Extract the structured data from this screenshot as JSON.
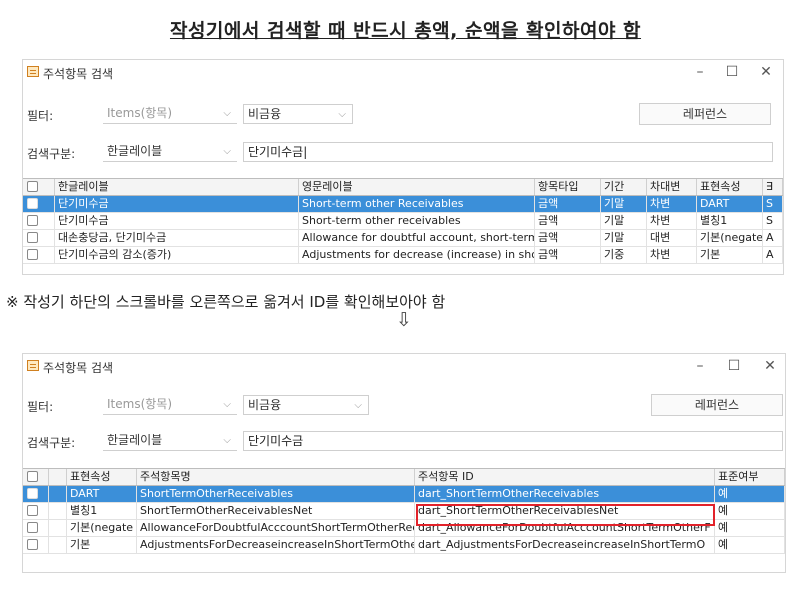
{
  "headline": "작성기에서 검색할 때 반드시 총액, 순액을 확인하여야 함",
  "note": "※ 작성기 하단의 스크롤바를 오른쪽으로 옮겨서 ID를 확인해보아야 함",
  "arrow_glyph": "⇩",
  "window_top": {
    "title": "주석항목 검색",
    "controls": {
      "minimize": "–",
      "maximize": "☐",
      "close": "✕"
    },
    "filter_label": "필터:",
    "filter_value": "Items(항목)",
    "filter2_value": "비금융",
    "reference_button": "레퍼런스",
    "search_type_label": "검색구분:",
    "search_type_value": "한글레이블",
    "search_input": "단기미수금|",
    "columns": [
      "",
      "한글레이블",
      "영문레이블",
      "항목타입",
      "기간",
      "차대변",
      "표현속성",
      "∃"
    ],
    "rows": [
      [
        "",
        "단기미수금",
        "Short-term other Receivables",
        "금액",
        "기말",
        "차변",
        "DART",
        "S"
      ],
      [
        "",
        "단기미수금",
        "Short-term other receivables",
        "금액",
        "기말",
        "차변",
        "별칭1",
        "S"
      ],
      [
        "",
        "대손충당금, 단기미수금",
        "Allowance for doubtful account, short-term",
        "금액",
        "기말",
        "대변",
        "기본(negate",
        "A"
      ],
      [
        "",
        "단기미수금의 감소(증가)",
        "Adjustments for decrease (increase) in sho",
        "금액",
        "기중",
        "차변",
        "기본",
        "A"
      ]
    ],
    "selected_row": 0
  },
  "window_bottom": {
    "title": "주석항목 검색",
    "controls": {
      "minimize": "–",
      "maximize": "☐",
      "close": "✕"
    },
    "filter_label": "필터:",
    "filter_value": "Items(항목)",
    "filter2_value": "비금융",
    "reference_button": "레퍼런스",
    "search_type_label": "검색구분:",
    "search_type_value": "한글레이블",
    "search_input": "단기미수금",
    "columns": [
      "",
      "",
      "표현속성",
      "주석항목명",
      "주석항목 ID",
      "표준여부"
    ],
    "rows": [
      [
        "",
        "",
        "DART",
        "ShortTermOtherReceivables",
        "dart_ShortTermOtherReceivables",
        "예"
      ],
      [
        "",
        "",
        "별칭1",
        "ShortTermOtherReceivablesNet",
        "dart_ShortTermOtherReceivablesNet",
        "예"
      ],
      [
        "",
        "",
        "기본(negate",
        "AllowanceForDoubtfulAcccountShortTermOtherRecei",
        "dart_AllowanceForDoubtfulAcccountShortTermOtherF",
        "예"
      ],
      [
        "",
        "",
        "기본",
        "AdjustmentsForDecreaseincreaseInShortTermOtherF",
        "dart_AdjustmentsForDecreaseincreaseInShortTermO",
        "예"
      ]
    ],
    "selected_row": 0,
    "highlighted_cell": {
      "row": 1,
      "column": 4,
      "color": "#e2222a"
    }
  },
  "colors": {
    "selection": "#3b8fd9",
    "highlight_border": "#e2222a"
  }
}
